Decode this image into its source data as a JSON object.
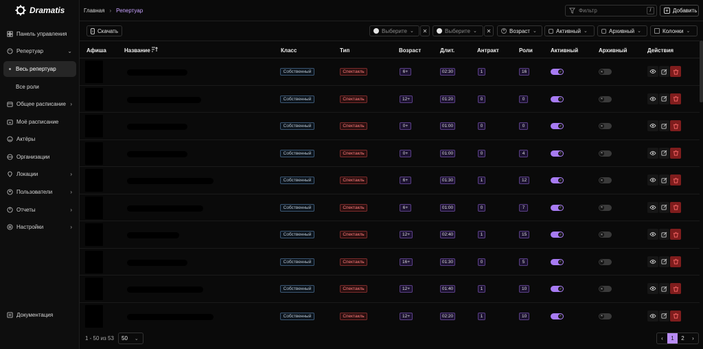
{
  "app": {
    "name": "Dramatis"
  },
  "sidebar": {
    "items": [
      {
        "label": "Панель управления",
        "icon": "dashboard-icon",
        "chevron": ""
      },
      {
        "label": "Репертуар",
        "icon": "theater-icon",
        "chevron": "down"
      },
      {
        "label": "Весь репертуар",
        "sub": true,
        "active": true
      },
      {
        "label": "Все роли",
        "sub": true
      },
      {
        "label": "Общее расписание",
        "icon": "calendar-icon",
        "chevron": "right"
      },
      {
        "label": "Моё расписание",
        "icon": "calendar-user-icon",
        "chevron": ""
      },
      {
        "label": "Актёры",
        "icon": "smile-icon",
        "chevron": ""
      },
      {
        "label": "Организации",
        "icon": "organization-icon",
        "chevron": ""
      },
      {
        "label": "Локации",
        "icon": "location-icon",
        "chevron": "right"
      },
      {
        "label": "Пользователи",
        "icon": "users-icon",
        "chevron": "right"
      },
      {
        "label": "Отчеты",
        "icon": "reports-icon",
        "chevron": "right"
      },
      {
        "label": "Настройки",
        "icon": "settings-icon",
        "chevron": "right"
      }
    ],
    "docs": {
      "label": "Документация",
      "icon": "documentation-icon"
    }
  },
  "header": {
    "breadcrumb": {
      "home": "Главная",
      "current": "Репертуар"
    },
    "filter_placeholder": "Фильтр",
    "filter_shortcut": "/",
    "add_label": "Добавить"
  },
  "toolbar": {
    "download_label": "Скачать",
    "select1_placeholder": "Выберите",
    "select2_placeholder": "Выберите",
    "age_label": "Возраст",
    "active_label": "Активный",
    "archived_label": "Архивный",
    "columns_label": "Колонки"
  },
  "table": {
    "columns": [
      "Афиша",
      "Название",
      "Класс",
      "Тип",
      "Возраст",
      "Длит.",
      "Антракт",
      "Роли",
      "Активный",
      "Архивный",
      "Действия"
    ],
    "rows": [
      {
        "class": "Собственный",
        "type": "Спектакль",
        "age": "6+",
        "duration": "02:30",
        "intermission": "1",
        "roles": "16",
        "active": true,
        "archived": false,
        "name_len": 0.7
      },
      {
        "class": "Собственный",
        "type": "Спектакль",
        "age": "12+",
        "duration": "01:20",
        "intermission": "0",
        "roles": "0",
        "active": true,
        "archived": false,
        "name_len": 0.86
      },
      {
        "class": "Собственный",
        "type": "Спектакль",
        "age": "0+",
        "duration": "01:00",
        "intermission": "0",
        "roles": "0",
        "active": true,
        "archived": false,
        "name_len": 0.7
      },
      {
        "class": "Собственный",
        "type": "Спектакль",
        "age": "0+",
        "duration": "01:00",
        "intermission": "0",
        "roles": "4",
        "active": true,
        "archived": false,
        "name_len": 0.7
      },
      {
        "class": "Собственный",
        "type": "Спектакль",
        "age": "6+",
        "duration": "01:30",
        "intermission": "1",
        "roles": "12",
        "active": true,
        "archived": false,
        "name_len": 1.0
      },
      {
        "class": "Собственный",
        "type": "Спектакль",
        "age": "6+",
        "duration": "01:00",
        "intermission": "0",
        "roles": "7",
        "active": true,
        "archived": false,
        "name_len": 0.88
      },
      {
        "class": "Собственный",
        "type": "Спектакль",
        "age": "12+",
        "duration": "02:40",
        "intermission": "1",
        "roles": "15",
        "active": true,
        "archived": false,
        "name_len": 0.6
      },
      {
        "class": "Собственный",
        "type": "Спектакль",
        "age": "16+",
        "duration": "01:30",
        "intermission": "0",
        "roles": "5",
        "active": true,
        "archived": false,
        "name_len": 0.7
      },
      {
        "class": "Собственный",
        "type": "Спектакль",
        "age": "12+",
        "duration": "01:40",
        "intermission": "1",
        "roles": "10",
        "active": true,
        "archived": false,
        "name_len": 0.88
      },
      {
        "class": "Собственный",
        "type": "Спектакль",
        "age": "12+",
        "duration": "02:20",
        "intermission": "1",
        "roles": "10",
        "active": true,
        "archived": false,
        "name_len": 1.0
      }
    ]
  },
  "pagination": {
    "info": "1 - 50 из 53",
    "page_size": "50",
    "pages": [
      "1",
      "2"
    ],
    "current_page": "1"
  },
  "colors": {
    "accent": "#a77bf3",
    "danger": "#7f1d1d",
    "breadcrumb_active": "#c8a2ff"
  }
}
